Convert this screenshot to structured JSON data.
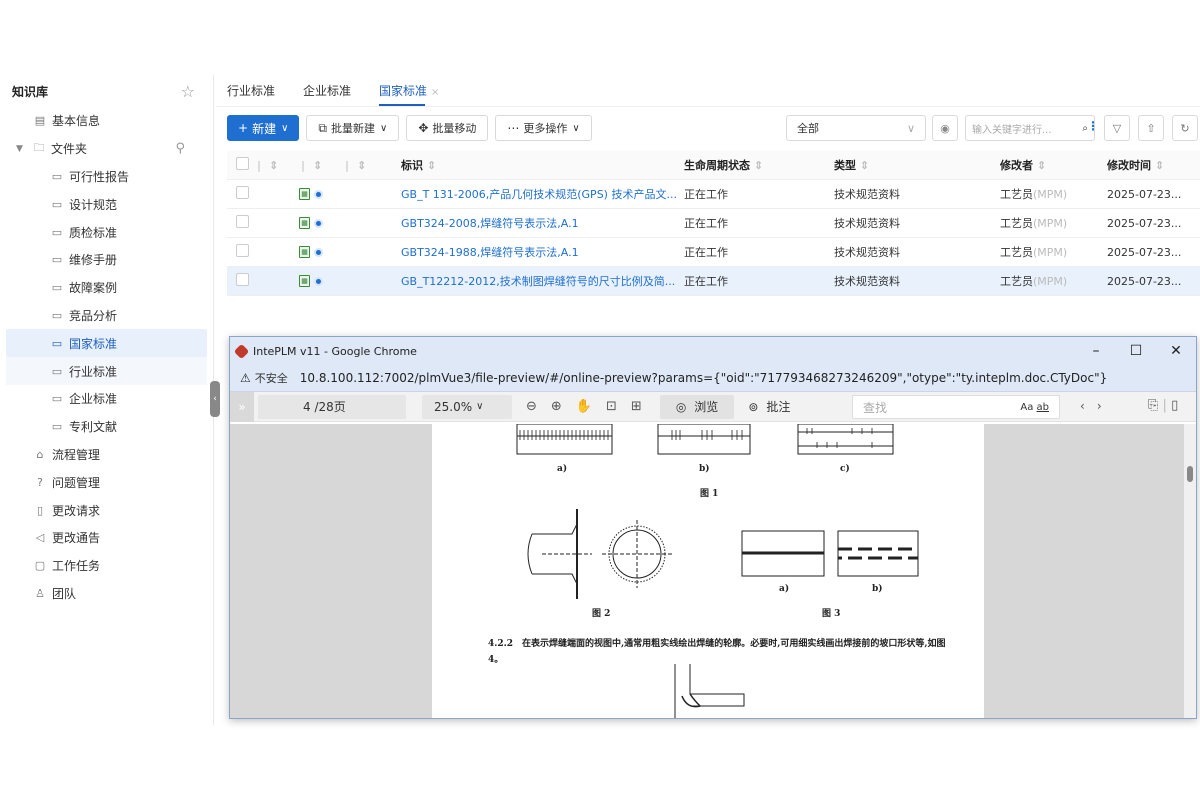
{
  "sidebar": {
    "title": "知识库",
    "items": [
      {
        "label": "基本信息",
        "icon": "doc-icon"
      },
      {
        "label": "文件夹",
        "icon": "folder-icon"
      },
      {
        "label": "可行性报告"
      },
      {
        "label": "设计规范"
      },
      {
        "label": "质检标准"
      },
      {
        "label": "维修手册"
      },
      {
        "label": "故障案例"
      },
      {
        "label": "竞品分析"
      },
      {
        "label": "国家标准"
      },
      {
        "label": "行业标准"
      },
      {
        "label": "企业标准"
      },
      {
        "label": "专利文献"
      },
      {
        "label": "流程管理"
      },
      {
        "label": "问题管理"
      },
      {
        "label": "更改请求"
      },
      {
        "label": "更改通告"
      },
      {
        "label": "工作任务"
      },
      {
        "label": "团队"
      }
    ]
  },
  "tabs": [
    {
      "label": "行业标准"
    },
    {
      "label": "企业标准"
    },
    {
      "label": "国家标准"
    }
  ],
  "toolbar": {
    "new_label": "新建",
    "batch_new_label": "批量新建",
    "batch_move_label": "批量移动",
    "more_label": "更多操作",
    "filter_value": "全部",
    "search_placeholder": "输入关键字进行..."
  },
  "table": {
    "headers": {
      "id": "标识",
      "lifecycle": "生命周期状态",
      "type": "类型",
      "modifier": "修改者",
      "modified_time": "修改时间"
    },
    "rows": [
      {
        "id": "GB_T 131-2006,产品几何技术规范(GPS) 技术产品文...",
        "lifecycle": "正在工作",
        "type": "技术规范资料",
        "modifier": "工艺员",
        "modifier_code": "(MPM)",
        "time": "2025-07-23..."
      },
      {
        "id": "GBT324-2008,焊缝符号表示法,A.1",
        "lifecycle": "正在工作",
        "type": "技术规范资料",
        "modifier": "工艺员",
        "modifier_code": "(MPM)",
        "time": "2025-07-23..."
      },
      {
        "id": "GBT324-1988,焊缝符号表示法,A.1",
        "lifecycle": "正在工作",
        "type": "技术规范资料",
        "modifier": "工艺员",
        "modifier_code": "(MPM)",
        "time": "2025-07-23..."
      },
      {
        "id": "GB_T12212-2012,技术制图焊缝符号的尺寸比例及简...",
        "lifecycle": "正在工作",
        "type": "技术规范资料",
        "modifier": "工艺员",
        "modifier_code": "(MPM)",
        "time": "2025-07-23..."
      }
    ]
  },
  "chrome": {
    "title": "IntePLM v11 - Google Chrome",
    "insecure_label": "不安全",
    "url": "10.8.100.112:7002/plmVue3/file-preview/#/online-preview?params={\"oid\":\"717793468273246209\",\"otype\":\"ty.inteplm.doc.CTyDoc\"}"
  },
  "preview": {
    "page_indicator": "4 /28页",
    "zoom": "25.0%",
    "browse_label": "浏览",
    "annotate_label": "批注",
    "search_placeholder": "查找",
    "match_case": "Aa",
    "whole_word": "ab",
    "doc": {
      "fig1_sub_a": "a)",
      "fig1_sub_b": "b)",
      "fig1_sub_c": "c)",
      "fig1_label": "图 1",
      "fig2_label": "图 2",
      "fig3_sub_a": "a)",
      "fig3_sub_b": "b)",
      "fig3_label": "图 3",
      "paragraph": "4.2.2　在表示焊缝端面的视图中,通常用粗实线绘出焊缝的轮廓。必要时,可用细实线画出焊接前的坡口形状等,如图 4。"
    }
  }
}
